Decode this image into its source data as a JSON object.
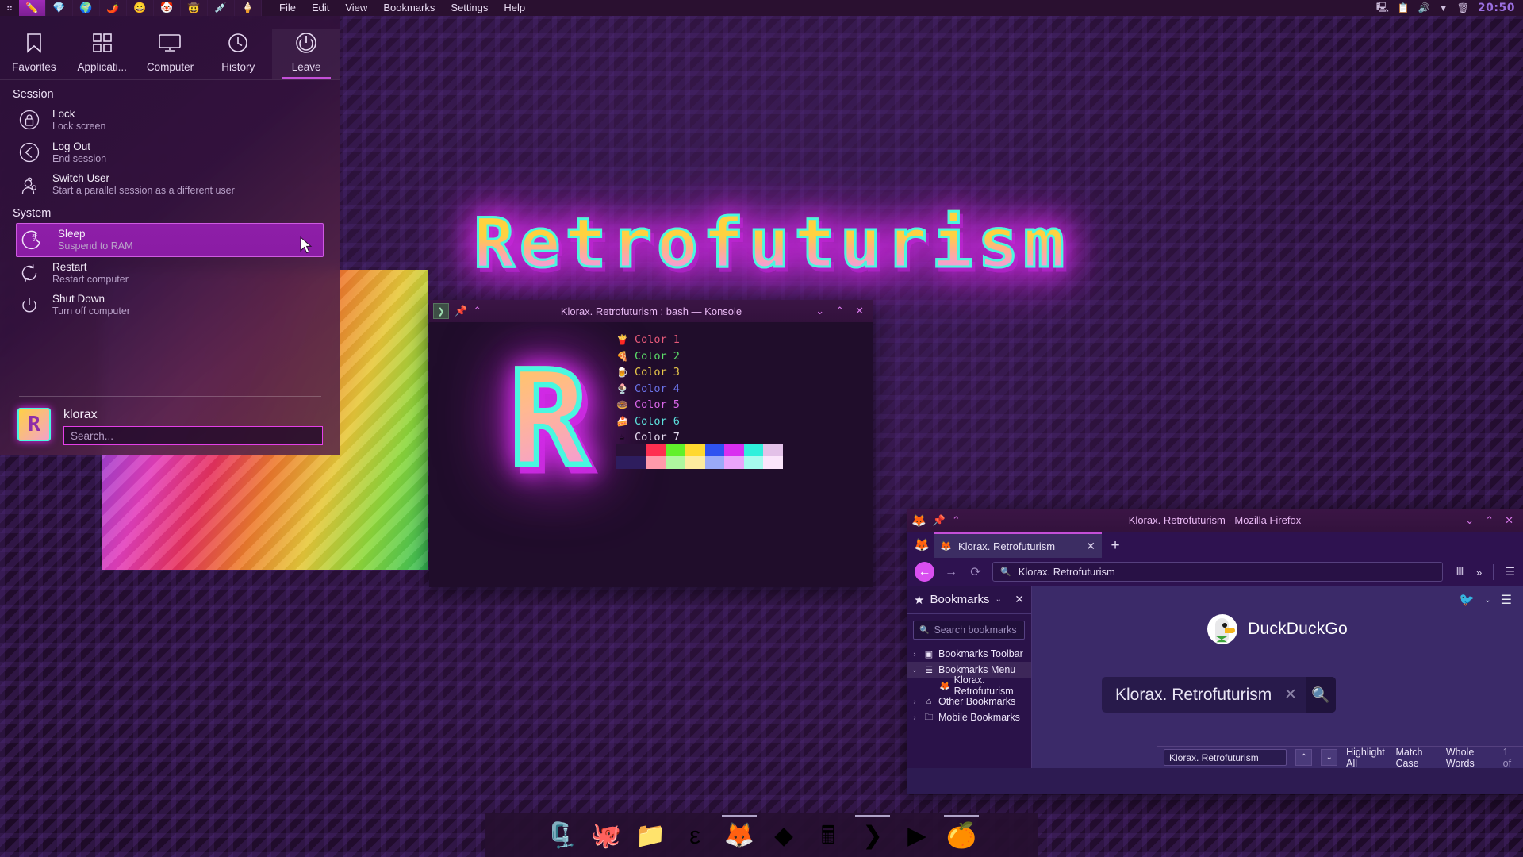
{
  "desktop": {
    "wallpaper_title": "Retrofuturism",
    "accent": "#d92ae8",
    "panel_bg": "#2a1030"
  },
  "top_panel": {
    "kmenu_icon": "kde-menu-icon",
    "activities": [
      "✏️",
      "💎",
      "🌍",
      "🌶️",
      "😀",
      "🤡",
      "🤠",
      "💉",
      "🍦"
    ],
    "menus": [
      "File",
      "Edit",
      "View",
      "Bookmarks",
      "Settings",
      "Help"
    ],
    "tray": [
      "display-icon",
      "clipboard-icon",
      "volume-icon",
      "chevron-down-icon",
      "trash-icon"
    ],
    "clock": "20:50"
  },
  "kickoff": {
    "tabs": [
      {
        "label": "Favorites",
        "icon": "bookmark-icon",
        "active": false
      },
      {
        "label": "Applicati...",
        "icon": "grid-icon",
        "active": false
      },
      {
        "label": "Computer",
        "icon": "monitor-icon",
        "active": false
      },
      {
        "label": "History",
        "icon": "clock-icon",
        "active": false
      },
      {
        "label": "Leave",
        "icon": "power-icon",
        "active": true
      }
    ],
    "groups": [
      {
        "title": "Session",
        "items": [
          {
            "label": "Lock",
            "sub": "Lock screen",
            "icon": "lock-icon",
            "selected": false
          },
          {
            "label": "Log Out",
            "sub": "End session",
            "icon": "logout-icon",
            "selected": false
          },
          {
            "label": "Switch User",
            "sub": "Start a parallel session as a different user",
            "icon": "switch-user-icon",
            "selected": false
          }
        ]
      },
      {
        "title": "System",
        "items": [
          {
            "label": "Sleep",
            "sub": "Suspend to RAM",
            "icon": "moon-icon",
            "selected": true
          },
          {
            "label": "Restart",
            "sub": "Restart computer",
            "icon": "restart-icon",
            "selected": false
          },
          {
            "label": "Shut Down",
            "sub": "Turn off computer",
            "icon": "shutdown-icon",
            "selected": false
          }
        ]
      }
    ],
    "user": {
      "name": "klorax",
      "avatar_letter": "R",
      "search_placeholder": "Search...",
      "search_value": ""
    }
  },
  "konsole": {
    "title": "Klorax. Retrofuturism : bash — Konsole",
    "titlebar_icons": [
      "app-menu-icon",
      "pin-icon",
      "keep-above-icon"
    ],
    "window_buttons": [
      "minimize-icon",
      "maximize-icon",
      "close-icon"
    ],
    "logo_letter": "R",
    "lines": [
      {
        "emoji": "🍟",
        "text": "Color 1",
        "color": "#e85a7a"
      },
      {
        "emoji": "🍕",
        "text": "Color 2",
        "color": "#5ce06a"
      },
      {
        "emoji": "🍺",
        "text": "Color 3",
        "color": "#e8c84a"
      },
      {
        "emoji": "🍨",
        "text": "Color 4",
        "color": "#6b73e8"
      },
      {
        "emoji": "🍩",
        "text": "Color 5",
        "color": "#d966e8"
      },
      {
        "emoji": "🍰",
        "text": "Color 6",
        "color": "#5ce0dc"
      },
      {
        "emoji": "☕",
        "text": "Color 7",
        "color": "#e6dcf0"
      }
    ],
    "palette_bright": [
      "#2b1138",
      "#ff2f50",
      "#61f02b",
      "#ffd82f",
      "#2f52f0",
      "#d92ef0",
      "#2ff0dc",
      "#e3c1e8"
    ],
    "palette_dim": [
      "#2e1d5e",
      "#ff9aab",
      "#aef79f",
      "#fdeb9e",
      "#9aaaf7",
      "#eaa4fb",
      "#a6fbee",
      "#fbe5fb"
    ]
  },
  "firefox": {
    "title": "Klorax. Retrofuturism - Mozilla Firefox",
    "titlebar_icons": [
      "firefox-icon",
      "pin-icon",
      "keep-above-icon"
    ],
    "window_buttons": [
      "minimize-icon",
      "maximize-icon",
      "close-icon"
    ],
    "tab": {
      "label": "Klorax. Retrofuturism",
      "favicon": "firefox-icon",
      "close": "close-icon"
    },
    "new_tab_label": "+",
    "nav": {
      "back": "back-icon",
      "forward": "forward-icon",
      "reload": "reload-icon",
      "url_value": "Klorax. Retrofuturism",
      "url_icon": "search-icon",
      "library": "library-icon",
      "overflow": "chevron-double-right-icon",
      "menu": "hamburger-icon"
    },
    "sidebar": {
      "title": "Bookmarks",
      "dropdown": "chevron-down-icon",
      "close": "close-icon",
      "search_placeholder": "Search bookmarks",
      "items": [
        {
          "label": "Bookmarks Toolbar",
          "twisty": "›",
          "icon": "toolbar-icon",
          "child": false,
          "selected": false
        },
        {
          "label": "Bookmarks Menu",
          "twisty": "⌄",
          "icon": "menu-list-icon",
          "child": false,
          "selected": true
        },
        {
          "label": "Klorax. Retrofuturism",
          "twisty": "",
          "icon": "firefox-icon",
          "child": true,
          "selected": false
        },
        {
          "label": "Other Bookmarks",
          "twisty": "›",
          "icon": "inbox-icon",
          "child": false,
          "selected": false
        },
        {
          "label": "Mobile Bookmarks",
          "twisty": "›",
          "icon": "folder-icon",
          "child": false,
          "selected": false
        }
      ]
    },
    "page": {
      "brand": "DuckDuckGo",
      "twitter_icon": "twitter-icon",
      "twitter_chevron": "chevron-down-icon",
      "hamburger": "hamburger-icon",
      "search_value": "Klorax. Retrofuturism",
      "clear_icon": "close-icon",
      "search_icon": "search-icon"
    },
    "findbar": {
      "value": "Klorax. Retrofuturism",
      "prev": "chevron-up-icon",
      "next": "chevron-down-icon",
      "highlight_all": "Highlight All",
      "match_case": "Match Case",
      "whole_words": "Whole Words",
      "count": "1 of"
    }
  },
  "dock": {
    "items": [
      {
        "name": "archive-manager",
        "glyph": "🗜️"
      },
      {
        "name": "krita",
        "glyph": "🐙"
      },
      {
        "name": "file-manager",
        "glyph": "📁"
      },
      {
        "name": "emacs",
        "glyph": "ε"
      },
      {
        "name": "firefox",
        "glyph": "🦊"
      },
      {
        "name": "gimp-dark",
        "glyph": "◆"
      },
      {
        "name": "calculator",
        "glyph": "🖩"
      },
      {
        "name": "konsole",
        "glyph": "❯"
      },
      {
        "name": "media-player",
        "glyph": "▶"
      },
      {
        "name": "orange-app",
        "glyph": "🍊"
      }
    ],
    "running": [
      4,
      7,
      9
    ]
  }
}
